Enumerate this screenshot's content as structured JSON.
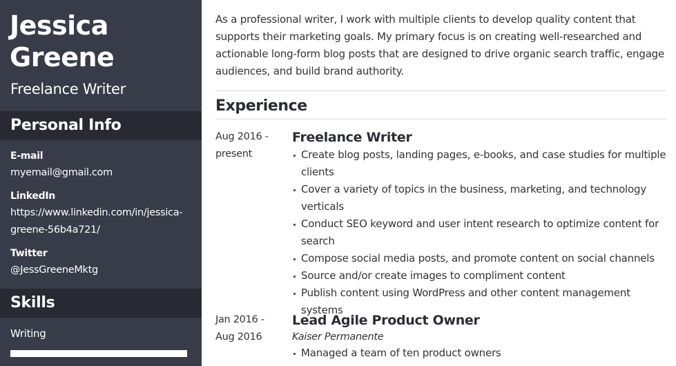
{
  "profile": {
    "name_line1": "Jessica",
    "name_line2": "Greene",
    "title": "Freelance Writer"
  },
  "personal_info": {
    "heading": "Personal Info",
    "items": [
      {
        "label": "E-mail",
        "value_lines": [
          "myemail@gmail.com"
        ]
      },
      {
        "label": "LinkedIn",
        "value_lines": [
          "https://www.linkedin.com/in/jessica-",
          "greene-56b4a721/"
        ]
      },
      {
        "label": "Twitter",
        "value_lines": [
          "@JessGreeneMktg"
        ]
      }
    ]
  },
  "skills": {
    "heading": "Skills",
    "items": [
      {
        "label": "Writing",
        "level_percent": 100
      }
    ]
  },
  "summary": "As a professional writer, I work with multiple clients to develop quality content that supports their marketing goals. My primary focus is on creating well-researched and actionable long-form blog posts that are designed to drive organic search traffic, engage audiences, and build brand authority.",
  "experience": {
    "heading": "Experience",
    "jobs": [
      {
        "dates_line1": "Aug 2016 -",
        "dates_line2": "present",
        "title": "Freelance Writer",
        "company": "",
        "bullets": [
          "Create blog posts, landing pages, e-books, and case studies for multiple clients",
          "Cover a variety of topics in the business, marketing, and technology verticals",
          "Conduct SEO keyword and user intent research to optimize content for search",
          "Compose social media posts, and promote content on social channels",
          "Source and/or create images to compliment content",
          "Publish content using WordPress and other content management systems"
        ]
      },
      {
        "dates_line1": "Jan 2016 -",
        "dates_line2": "Aug 2016",
        "title": "Lead Agile Product Owner",
        "company": "Kaiser Permanente",
        "bullets": [
          "Managed a team of ten product owners"
        ]
      }
    ]
  },
  "colors": {
    "sidebar_bg": "#373c48",
    "section_band_bg": "#272a33",
    "body_text": "#333333",
    "divider": "#d8d8d8"
  }
}
